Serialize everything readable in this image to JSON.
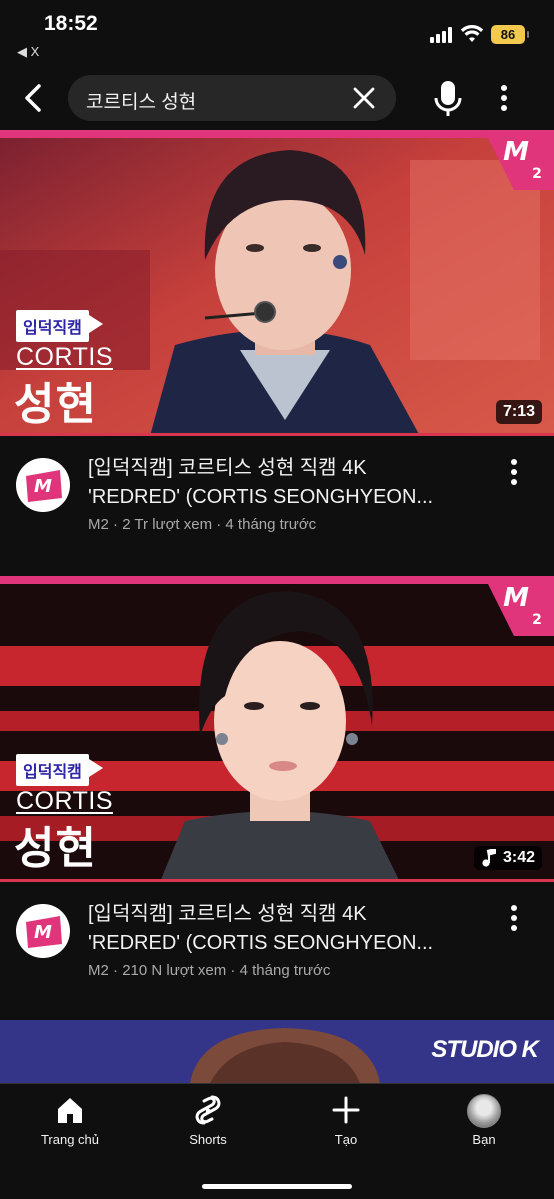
{
  "status_bar": {
    "time": "18:52",
    "back_app_label": "◀ X",
    "battery": "86"
  },
  "search": {
    "query": "코르티스 성현"
  },
  "videos": [
    {
      "title_line1": "[입덕직캠] 코르티스 성현 직캠 4K",
      "title_line2": "'REDRED' (CORTIS SEONGHYEON...",
      "channel": "M2",
      "views": "2 Tr lượt xem",
      "age": "4 tháng trước",
      "duration": "7:13",
      "overlay_badge": "입덕직캠",
      "overlay_group": "CORTIS",
      "overlay_name": "성현",
      "watched_fraction": 1.0
    },
    {
      "title_line1": "[입덕직캠] 코르티스 성현 직캠 4K",
      "title_line2": "'REDRED' (CORTIS SEONGHYEON...",
      "channel": "M2",
      "views": "210 N lượt xem",
      "age": "4 tháng trước",
      "duration": "3:42",
      "overlay_badge": "입덕직캠",
      "overlay_group": "CORTIS",
      "overlay_name": "성현",
      "watched_fraction": 1.0
    }
  ],
  "partial_video": {
    "logo_text": "STUDIO K"
  },
  "bottom_nav": {
    "home": "Trang chủ",
    "shorts": "Shorts",
    "create": "Tạo",
    "you": "Bạn"
  },
  "colors": {
    "background": "#0f0f0f",
    "accent_red": "#d9354f",
    "m2_pink": "#e0357a"
  },
  "icons": [
    "back-arrow-icon",
    "clear-icon",
    "mic-icon",
    "more-vert-icon",
    "home-icon",
    "shorts-icon",
    "plus-icon",
    "music-note-icon"
  ]
}
